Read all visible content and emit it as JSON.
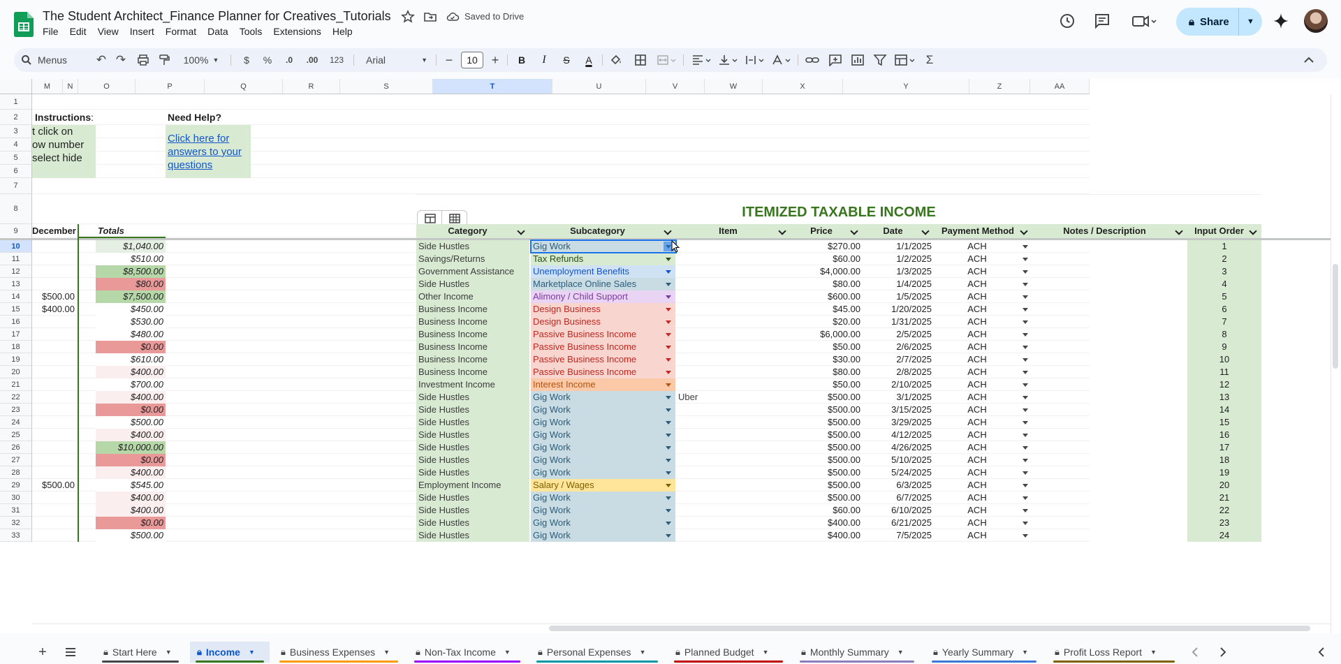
{
  "doc": {
    "title": "The Student Architect_Finance Planner for Creatives_Tutorials",
    "saved_status": "Saved to Drive",
    "menus": [
      "File",
      "Edit",
      "View",
      "Insert",
      "Format",
      "Data",
      "Tools",
      "Extensions",
      "Help"
    ],
    "share_label": "Share"
  },
  "toolbar": {
    "menus_label": "Menus",
    "zoom": "100%",
    "currency": "$",
    "percent": "%",
    "dec_decrease": ".0",
    "dec_increase": ".00",
    "number_format": "123",
    "font": "Arial",
    "font_size": "10",
    "bold": "B",
    "italic": "I",
    "strike": "S",
    "text_color": "A",
    "function": "Σ"
  },
  "columns": [
    {
      "label": "M"
    },
    {
      "label": "N"
    },
    {
      "label": "O"
    },
    {
      "label": "P"
    },
    {
      "label": "Q"
    },
    {
      "label": "R"
    },
    {
      "label": "S"
    },
    {
      "label": "T"
    },
    {
      "label": "U"
    },
    {
      "label": "V"
    },
    {
      "label": "W"
    },
    {
      "label": "X"
    },
    {
      "label": "Y"
    },
    {
      "label": "Z"
    },
    {
      "label": "AA"
    }
  ],
  "selected_column": "T",
  "selected_row": "10",
  "colors": {
    "green_cell": "#d9ead3",
    "green_light": "#e6efe3",
    "red_cell": "#ea9999",
    "red_light": "#f4cccc",
    "red_faint": "#fbeeee",
    "green_dark": "#b6d7a8",
    "title_green": "#38761d",
    "link_blue": "#1155cc"
  },
  "left_panel": {
    "instructions_label": "Instructions",
    "instructions_colon": ":",
    "instructions_lines": [
      "t click on",
      "ow number",
      "select hide"
    ],
    "help_label": "Need Help?",
    "help_link_lines": [
      "Click here for",
      "answers to your",
      "questions"
    ],
    "december_label": "December",
    "totals_label": "Totals",
    "december_values": [
      "",
      "",
      "",
      "",
      "$500.00",
      "$400.00",
      "",
      "",
      "",
      "",
      "",
      "",
      "",
      "",
      "",
      "",
      "",
      "",
      "",
      "$500.00",
      "",
      "",
      "",
      ""
    ],
    "totals_values": [
      "$1,040.00",
      "$510.00",
      "$8,500.00",
      "$80.00",
      "$7,500.00",
      "$450.00",
      "$530.00",
      "$480.00",
      "$0.00",
      "$610.00",
      "$400.00",
      "$700.00",
      "$400.00",
      "$0.00",
      "$500.00",
      "$400.00",
      "$10,000.00",
      "$0.00",
      "$400.00",
      "$545.00",
      "$400.00",
      "$400.00",
      "$0.00",
      "$500.00"
    ],
    "totals_styles": [
      "light",
      "",
      "green",
      "red",
      "green",
      "",
      "",
      "",
      "red",
      "",
      "faint",
      "",
      "faint",
      "red",
      "",
      "faint",
      "green",
      "red",
      "faint",
      "",
      "faint",
      "faint",
      "red",
      ""
    ]
  },
  "table": {
    "title": "ITEMIZED TAXABLE INCOME",
    "headers": [
      "Category",
      "Subcategory",
      "Item",
      "Price",
      "Date",
      "Payment Method",
      "Notes / Description",
      "Input Order"
    ],
    "rows": [
      {
        "category": "Side Hustles",
        "subcategory": "Gig Work",
        "item": "",
        "price": "$270.00",
        "date": "1/1/2025",
        "method": "ACH",
        "order": "1",
        "sub_style": "gig"
      },
      {
        "category": "Savings/Returns",
        "subcategory": "Tax Refunds",
        "item": "",
        "price": "$60.00",
        "date": "1/2/2025",
        "method": "ACH",
        "order": "2",
        "sub_style": "tax"
      },
      {
        "category": "Government Assistance",
        "subcategory": "Unemployment Benefits",
        "item": "",
        "price": "$4,000.00",
        "date": "1/3/2025",
        "method": "ACH",
        "order": "3",
        "sub_style": "unemp"
      },
      {
        "category": "Side Hustles",
        "subcategory": "Marketplace Online Sales",
        "item": "",
        "price": "$80.00",
        "date": "1/4/2025",
        "method": "ACH",
        "order": "4",
        "sub_style": "gig"
      },
      {
        "category": "Other Income",
        "subcategory": "Alimony / Child Support",
        "item": "",
        "price": "$600.00",
        "date": "1/5/2025",
        "method": "ACH",
        "order": "5",
        "sub_style": "alimony"
      },
      {
        "category": "Business Income",
        "subcategory": "Design Business",
        "item": "",
        "price": "$45.00",
        "date": "1/20/2025",
        "method": "ACH",
        "order": "6",
        "sub_style": "biz"
      },
      {
        "category": "Business Income",
        "subcategory": "Design Business",
        "item": "",
        "price": "$20.00",
        "date": "1/31/2025",
        "method": "ACH",
        "order": "7",
        "sub_style": "biz"
      },
      {
        "category": "Business Income",
        "subcategory": "Passive Business Income",
        "item": "",
        "price": "$6,000.00",
        "date": "2/5/2025",
        "method": "ACH",
        "order": "8",
        "sub_style": "biz"
      },
      {
        "category": "Business Income",
        "subcategory": "Passive Business Income",
        "item": "",
        "price": "$50.00",
        "date": "2/6/2025",
        "method": "ACH",
        "order": "9",
        "sub_style": "biz"
      },
      {
        "category": "Business Income",
        "subcategory": "Passive Business Income",
        "item": "",
        "price": "$30.00",
        "date": "2/7/2025",
        "method": "ACH",
        "order": "10",
        "sub_style": "biz"
      },
      {
        "category": "Business Income",
        "subcategory": "Passive Business Income",
        "item": "",
        "price": "$80.00",
        "date": "2/8/2025",
        "method": "ACH",
        "order": "11",
        "sub_style": "biz"
      },
      {
        "category": "Investment Income",
        "subcategory": "Interest Income",
        "item": "",
        "price": "$50.00",
        "date": "2/10/2025",
        "method": "ACH",
        "order": "12",
        "sub_style": "interest"
      },
      {
        "category": "Side Hustles",
        "subcategory": "Gig Work",
        "item": "Uber",
        "price": "$500.00",
        "date": "3/1/2025",
        "method": "ACH",
        "order": "13",
        "sub_style": "gig"
      },
      {
        "category": "Side Hustles",
        "subcategory": "Gig Work",
        "item": "",
        "price": "$500.00",
        "date": "3/15/2025",
        "method": "ACH",
        "order": "14",
        "sub_style": "gig"
      },
      {
        "category": "Side Hustles",
        "subcategory": "Gig Work",
        "item": "",
        "price": "$500.00",
        "date": "3/29/2025",
        "method": "ACH",
        "order": "15",
        "sub_style": "gig"
      },
      {
        "category": "Side Hustles",
        "subcategory": "Gig Work",
        "item": "",
        "price": "$500.00",
        "date": "4/12/2025",
        "method": "ACH",
        "order": "16",
        "sub_style": "gig"
      },
      {
        "category": "Side Hustles",
        "subcategory": "Gig Work",
        "item": "",
        "price": "$500.00",
        "date": "4/26/2025",
        "method": "ACH",
        "order": "17",
        "sub_style": "gig"
      },
      {
        "category": "Side Hustles",
        "subcategory": "Gig Work",
        "item": "",
        "price": "$500.00",
        "date": "5/10/2025",
        "method": "ACH",
        "order": "18",
        "sub_style": "gig"
      },
      {
        "category": "Side Hustles",
        "subcategory": "Gig Work",
        "item": "",
        "price": "$500.00",
        "date": "5/24/2025",
        "method": "ACH",
        "order": "19",
        "sub_style": "gig"
      },
      {
        "category": "Employment Income",
        "subcategory": "Salary / Wages",
        "item": "",
        "price": "$500.00",
        "date": "6/3/2025",
        "method": "ACH",
        "order": "20",
        "sub_style": "salary"
      },
      {
        "category": "Side Hustles",
        "subcategory": "Gig Work",
        "item": "",
        "price": "$500.00",
        "date": "6/7/2025",
        "method": "ACH",
        "order": "21",
        "sub_style": "gig"
      },
      {
        "category": "Side Hustles",
        "subcategory": "Gig Work",
        "item": "",
        "price": "$60.00",
        "date": "6/10/2025",
        "method": "ACH",
        "order": "22",
        "sub_style": "gig"
      },
      {
        "category": "Side Hustles",
        "subcategory": "Gig Work",
        "item": "",
        "price": "$400.00",
        "date": "6/21/2025",
        "method": "ACH",
        "order": "23",
        "sub_style": "gig"
      },
      {
        "category": "Side Hustles",
        "subcategory": "Gig Work",
        "item": "",
        "price": "$400.00",
        "date": "7/5/2025",
        "method": "ACH",
        "order": "24",
        "sub_style": "gig"
      }
    ]
  },
  "sub_styles": {
    "gig": {
      "bg": "#c9dbe3",
      "fg": "#2b5d7a"
    },
    "tax": {
      "bg": "#d9ead3",
      "fg": "#274e13"
    },
    "unemp": {
      "bg": "#cfe2f3",
      "fg": "#1155cc"
    },
    "alimony": {
      "bg": "#e9d5f3",
      "fg": "#7a3aa0"
    },
    "biz": {
      "bg": "#f9d5d0",
      "fg": "#c0271f"
    },
    "interest": {
      "bg": "#fcc9a8",
      "fg": "#b45309"
    },
    "salary": {
      "bg": "#ffe599",
      "fg": "#7f6000"
    }
  },
  "tabs": [
    {
      "label": "Start Here",
      "color": "#444746"
    },
    {
      "label": "Income",
      "color": "#38761d",
      "active": true
    },
    {
      "label": "Business Expenses",
      "color": "#ff9900"
    },
    {
      "label": "Non-Tax Income",
      "color": "#9900ff"
    },
    {
      "label": "Personal Expenses",
      "color": "#0097a7"
    },
    {
      "label": "Planned Budget",
      "color": "#c00000"
    },
    {
      "label": "Monthly Summary",
      "color": "#8e7cc3"
    },
    {
      "label": "Yearly Summary",
      "color": "#3c78d8"
    },
    {
      "label": "Profit Loss Report",
      "color": "#7f6000"
    }
  ]
}
